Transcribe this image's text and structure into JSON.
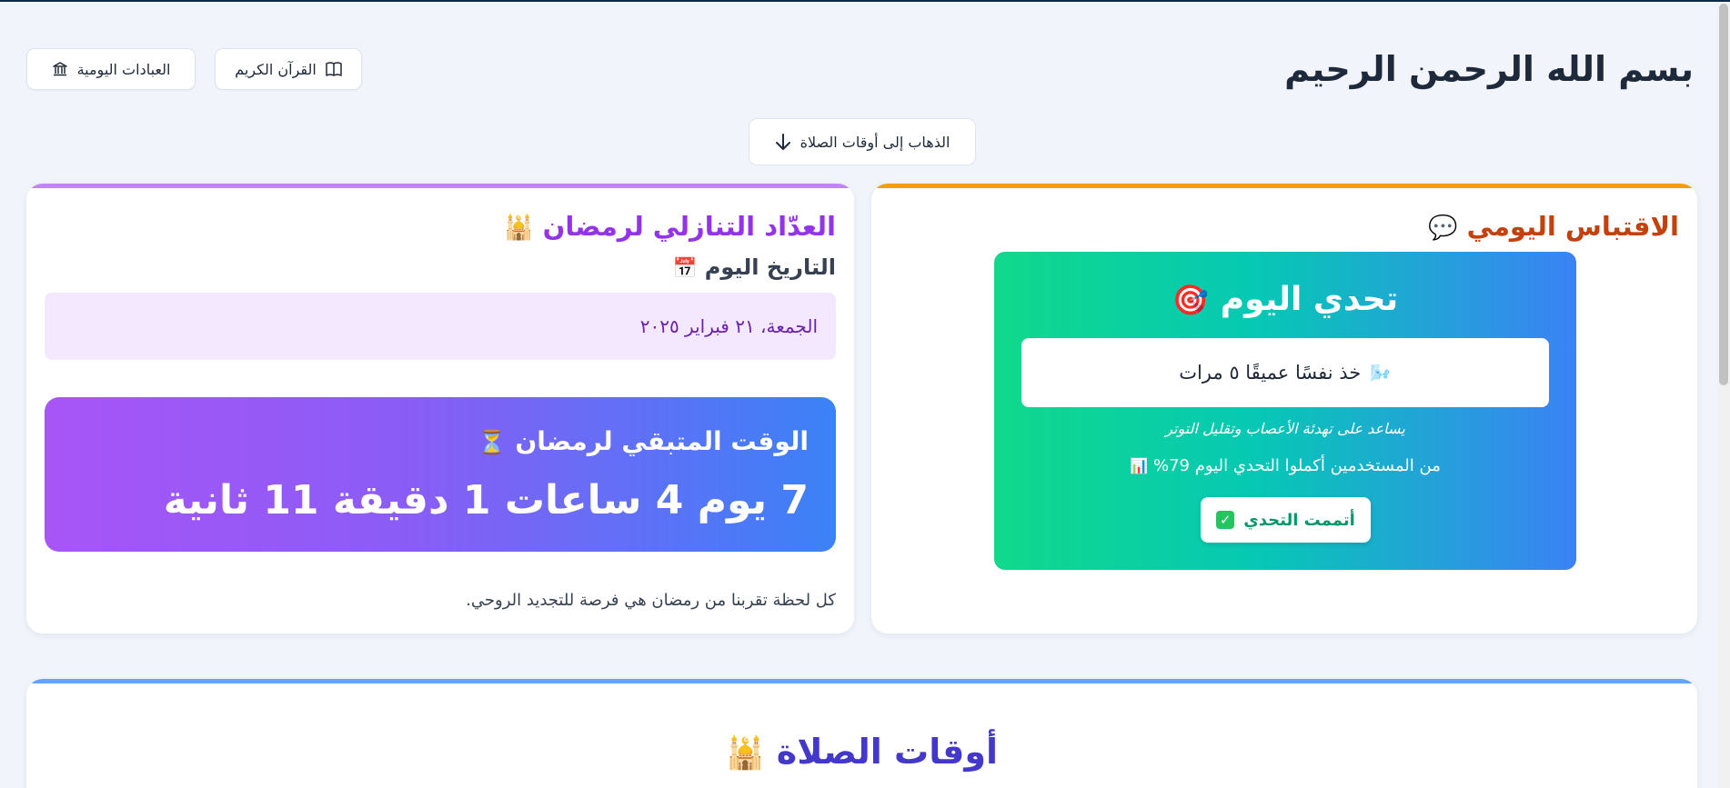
{
  "header": {
    "title": "بسم الله الرحمن الرحيم",
    "quran_button": "القرآن الكريم",
    "worship_button": "العبادات اليومية",
    "goto_prayer_button": "الذهاب إلى أوقات الصلاة"
  },
  "countdown": {
    "title": "العدّاد التنازلي لرمضان",
    "title_icon": "🕌",
    "today_label": "التاريخ اليوم",
    "today_icon": "📅",
    "date": "الجمعة، ٢١ فبراير ٢٠٢٥",
    "remaining_label": "الوقت المتبقي لرمضان",
    "remaining_icon": "⏳",
    "remaining_value": "7 يوم 4 ساعات 1 دقيقة 11 ثانية",
    "footer": "كل لحظة تقربنا من رمضان هي فرصة للتجديد الروحي."
  },
  "daily": {
    "title": "الاقتباس اليومي",
    "title_icon": "💬",
    "challenge": {
      "title": "تحدي اليوم",
      "title_icon": "🎯",
      "task": "خذ نفسًا عميقًا ٥ مرات",
      "task_icon": "🌬️",
      "description": "يساعد على تهدئة الأعصاب وتقليل التوتر",
      "stat": "من المستخدمين أكملوا التحدي اليوم 79%",
      "stat_icon": "📊",
      "done_button": "أتممت التحدي",
      "done_icon": "✓"
    }
  },
  "prayer": {
    "title": "أوقات الصلاة",
    "title_icon": "🕌"
  },
  "colors": {
    "countdown_accent": "#9333ea",
    "daily_accent": "#c2410c",
    "prayer_accent": "#4338ca"
  }
}
